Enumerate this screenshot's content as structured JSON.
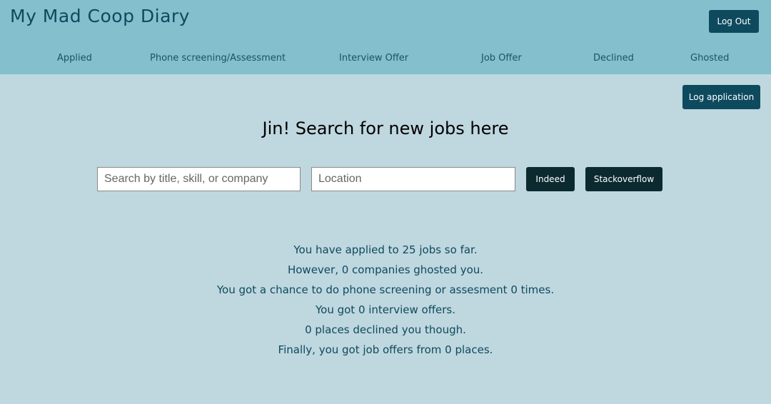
{
  "app": {
    "title": "My Mad Coop Diary"
  },
  "header": {
    "logout_label": "Log Out"
  },
  "nav": {
    "items": [
      {
        "label": "Applied"
      },
      {
        "label": "Phone screening/Assessment"
      },
      {
        "label": "Interview Offer"
      },
      {
        "label": "Job Offer"
      },
      {
        "label": "Declined"
      },
      {
        "label": "Ghosted"
      }
    ]
  },
  "actions": {
    "log_application_label": "Log application"
  },
  "search": {
    "heading": "Jin! Search for new jobs here",
    "query_placeholder": "Search by title, skill, or company",
    "query_value": "",
    "location_placeholder": "Location",
    "location_value": "",
    "buttons": [
      {
        "label": "Indeed"
      },
      {
        "label": "Stackoverflow"
      }
    ]
  },
  "stats": {
    "lines": [
      "You have applied to 25 jobs so far.",
      "However, 0 companies ghosted you.",
      "You got a chance to do phone screening or assesment 0 times.",
      "You got 0 interview offers.",
      "0 places declined you though.",
      "Finally, you got job offers from 0 places."
    ]
  },
  "colors": {
    "header_bg": "#83bfcc",
    "page_bg": "#bfd7df",
    "primary_button": "#0e4a5e",
    "search_button": "#0b2a30",
    "text_primary": "#0e4a5e"
  }
}
